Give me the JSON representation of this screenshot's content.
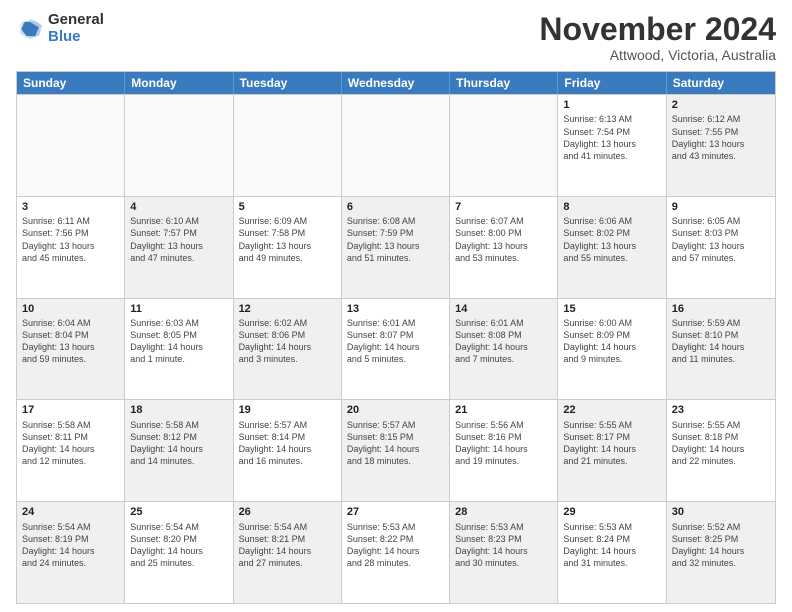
{
  "logo": {
    "general": "General",
    "blue": "Blue"
  },
  "header": {
    "title": "November 2024",
    "subtitle": "Attwood, Victoria, Australia"
  },
  "days": [
    "Sunday",
    "Monday",
    "Tuesday",
    "Wednesday",
    "Thursday",
    "Friday",
    "Saturday"
  ],
  "rows": [
    [
      {
        "day": "",
        "text": "",
        "empty": true
      },
      {
        "day": "",
        "text": "",
        "empty": true
      },
      {
        "day": "",
        "text": "",
        "empty": true
      },
      {
        "day": "",
        "text": "",
        "empty": true
      },
      {
        "day": "",
        "text": "",
        "empty": true
      },
      {
        "day": "1",
        "text": "Sunrise: 6:13 AM\nSunset: 7:54 PM\nDaylight: 13 hours\nand 41 minutes."
      },
      {
        "day": "2",
        "text": "Sunrise: 6:12 AM\nSunset: 7:55 PM\nDaylight: 13 hours\nand 43 minutes.",
        "shaded": true
      }
    ],
    [
      {
        "day": "3",
        "text": "Sunrise: 6:11 AM\nSunset: 7:56 PM\nDaylight: 13 hours\nand 45 minutes."
      },
      {
        "day": "4",
        "text": "Sunrise: 6:10 AM\nSunset: 7:57 PM\nDaylight: 13 hours\nand 47 minutes.",
        "shaded": true
      },
      {
        "day": "5",
        "text": "Sunrise: 6:09 AM\nSunset: 7:58 PM\nDaylight: 13 hours\nand 49 minutes."
      },
      {
        "day": "6",
        "text": "Sunrise: 6:08 AM\nSunset: 7:59 PM\nDaylight: 13 hours\nand 51 minutes.",
        "shaded": true
      },
      {
        "day": "7",
        "text": "Sunrise: 6:07 AM\nSunset: 8:00 PM\nDaylight: 13 hours\nand 53 minutes."
      },
      {
        "day": "8",
        "text": "Sunrise: 6:06 AM\nSunset: 8:02 PM\nDaylight: 13 hours\nand 55 minutes.",
        "shaded": true
      },
      {
        "day": "9",
        "text": "Sunrise: 6:05 AM\nSunset: 8:03 PM\nDaylight: 13 hours\nand 57 minutes."
      }
    ],
    [
      {
        "day": "10",
        "text": "Sunrise: 6:04 AM\nSunset: 8:04 PM\nDaylight: 13 hours\nand 59 minutes.",
        "shaded": true
      },
      {
        "day": "11",
        "text": "Sunrise: 6:03 AM\nSunset: 8:05 PM\nDaylight: 14 hours\nand 1 minute."
      },
      {
        "day": "12",
        "text": "Sunrise: 6:02 AM\nSunset: 8:06 PM\nDaylight: 14 hours\nand 3 minutes.",
        "shaded": true
      },
      {
        "day": "13",
        "text": "Sunrise: 6:01 AM\nSunset: 8:07 PM\nDaylight: 14 hours\nand 5 minutes."
      },
      {
        "day": "14",
        "text": "Sunrise: 6:01 AM\nSunset: 8:08 PM\nDaylight: 14 hours\nand 7 minutes.",
        "shaded": true
      },
      {
        "day": "15",
        "text": "Sunrise: 6:00 AM\nSunset: 8:09 PM\nDaylight: 14 hours\nand 9 minutes."
      },
      {
        "day": "16",
        "text": "Sunrise: 5:59 AM\nSunset: 8:10 PM\nDaylight: 14 hours\nand 11 minutes.",
        "shaded": true
      }
    ],
    [
      {
        "day": "17",
        "text": "Sunrise: 5:58 AM\nSunset: 8:11 PM\nDaylight: 14 hours\nand 12 minutes."
      },
      {
        "day": "18",
        "text": "Sunrise: 5:58 AM\nSunset: 8:12 PM\nDaylight: 14 hours\nand 14 minutes.",
        "shaded": true
      },
      {
        "day": "19",
        "text": "Sunrise: 5:57 AM\nSunset: 8:14 PM\nDaylight: 14 hours\nand 16 minutes."
      },
      {
        "day": "20",
        "text": "Sunrise: 5:57 AM\nSunset: 8:15 PM\nDaylight: 14 hours\nand 18 minutes.",
        "shaded": true
      },
      {
        "day": "21",
        "text": "Sunrise: 5:56 AM\nSunset: 8:16 PM\nDaylight: 14 hours\nand 19 minutes."
      },
      {
        "day": "22",
        "text": "Sunrise: 5:55 AM\nSunset: 8:17 PM\nDaylight: 14 hours\nand 21 minutes.",
        "shaded": true
      },
      {
        "day": "23",
        "text": "Sunrise: 5:55 AM\nSunset: 8:18 PM\nDaylight: 14 hours\nand 22 minutes."
      }
    ],
    [
      {
        "day": "24",
        "text": "Sunrise: 5:54 AM\nSunset: 8:19 PM\nDaylight: 14 hours\nand 24 minutes.",
        "shaded": true
      },
      {
        "day": "25",
        "text": "Sunrise: 5:54 AM\nSunset: 8:20 PM\nDaylight: 14 hours\nand 25 minutes."
      },
      {
        "day": "26",
        "text": "Sunrise: 5:54 AM\nSunset: 8:21 PM\nDaylight: 14 hours\nand 27 minutes.",
        "shaded": true
      },
      {
        "day": "27",
        "text": "Sunrise: 5:53 AM\nSunset: 8:22 PM\nDaylight: 14 hours\nand 28 minutes."
      },
      {
        "day": "28",
        "text": "Sunrise: 5:53 AM\nSunset: 8:23 PM\nDaylight: 14 hours\nand 30 minutes.",
        "shaded": true
      },
      {
        "day": "29",
        "text": "Sunrise: 5:53 AM\nSunset: 8:24 PM\nDaylight: 14 hours\nand 31 minutes."
      },
      {
        "day": "30",
        "text": "Sunrise: 5:52 AM\nSunset: 8:25 PM\nDaylight: 14 hours\nand 32 minutes.",
        "shaded": true
      }
    ]
  ]
}
